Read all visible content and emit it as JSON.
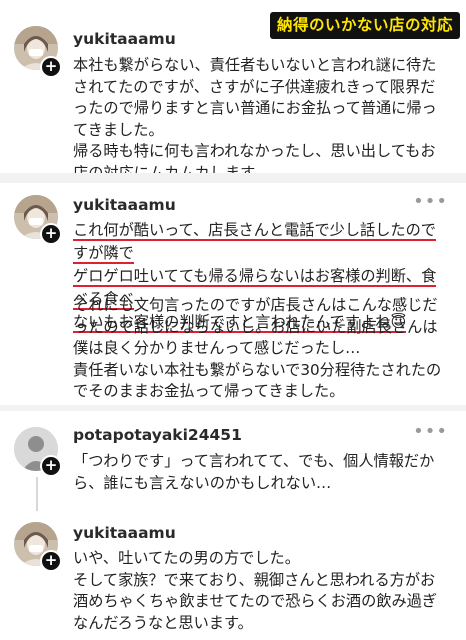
{
  "banner": "納得のいかない店の対応",
  "posts": [
    {
      "username": "yukitaaamu",
      "text": "本社も繋がらない、責任者もいないと言われ謎に待たされてたのですが、さすがに子供達疲れきって限界だったので帰りますと言い普通にお金払って普通に帰ってきました。\n帰る時も特に何も言われなかったし、思い出してもお店の対応にムカムカします。"
    },
    {
      "username": "yukitaaamu",
      "highlight_lines": [
        "これ何が酷いって、店長さんと電話で少し話したのですが隣で",
        "ゲロゲロ吐いてても帰る帰らないはお客様の判断、食べる食べ",
        "ないもお客様の判断ですと言われたんですよね😇"
      ],
      "text": "それにも文句言ったのですが店長さんはこんな感じだったので話しにならないし。お店にいた副店長さんは僕は良く分かりませんって感じだったし…\n責任者いない本社も繋がらないで30分程待たされたのでそのままお金払って帰ってきました。"
    },
    {
      "username": "potapotayaki24451",
      "text": "「つわりです」って言われてて、でも、個人情報だから、誰にも言えないのかもしれない…"
    },
    {
      "username": "yukitaaamu",
      "text": "いや、吐いてたの男の方でした。\nそして家族？で来ており、親御さんと思われる方がお酒めちゃくちゃ飲ませてたので恐らくお酒の飲み過ぎなんだろうなと思います。"
    }
  ],
  "more_icon": "more-horizontal-icon",
  "plus_icon": "follow-plus-icon"
}
